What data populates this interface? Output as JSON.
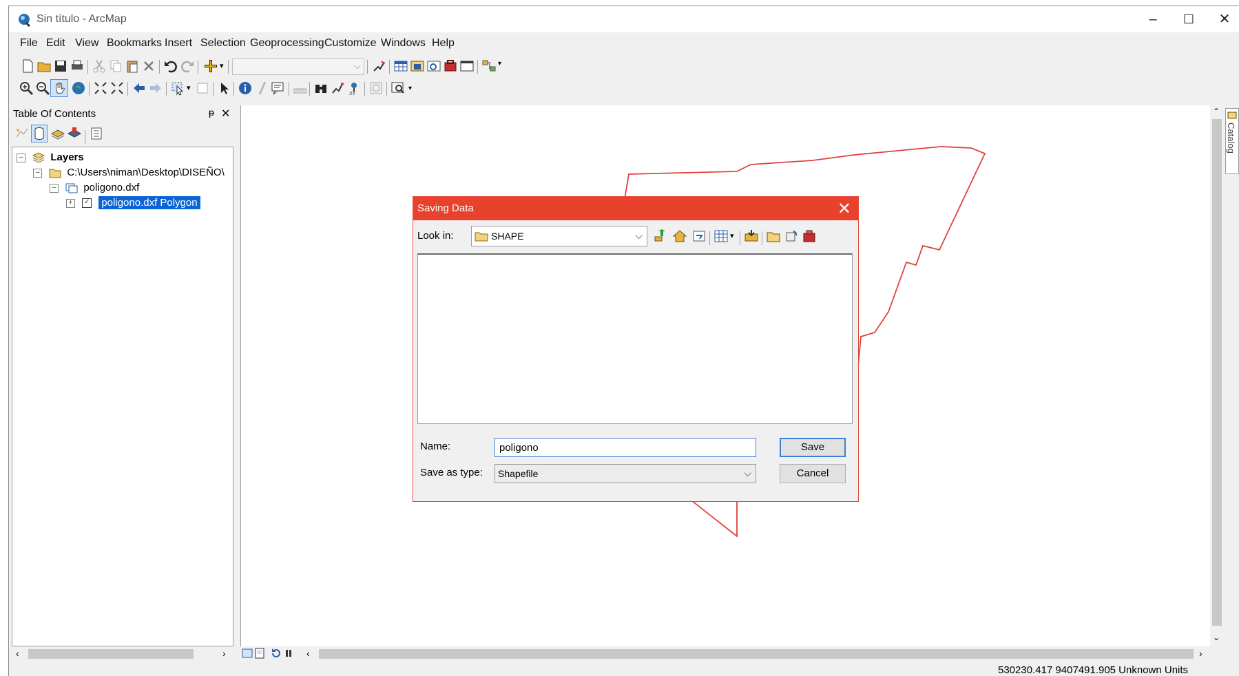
{
  "window": {
    "title": "Sin título - ArcMap",
    "minimize": "–",
    "maximize": "☐",
    "close": "✕"
  },
  "menu": [
    "File",
    "Edit",
    "View",
    "Bookmarks",
    "Insert",
    "Selection",
    "Geoprocessing",
    "Customize",
    "Windows",
    "Help"
  ],
  "toc": {
    "title": "Table Of Contents",
    "pin": "ᵽ",
    "close": "✕",
    "tree": {
      "layers": "Layers",
      "folder": "C:\\Users\\niman\\Desktop\\DISEÑO\\",
      "dxf": "poligono.dxf",
      "polygon_layer": "poligono.dxf Polygon"
    }
  },
  "catalog_tab": "Catalog",
  "dialog": {
    "title": "Saving Data",
    "close": "✕",
    "look_in_label": "Look in:",
    "look_in_value": "SHAPE",
    "name_label": "Name:",
    "name_value": "poligono",
    "type_label": "Save as type:",
    "type_value": "Shapefile",
    "save": "Save",
    "cancel": "Cancel"
  },
  "status": {
    "coordinates": "530230.417  9407491.905 Unknown Units"
  },
  "colors": {
    "polygon_stroke": "#e0413a",
    "dialog_titlebar": "#e8412c",
    "selection": "#0a64d8"
  }
}
